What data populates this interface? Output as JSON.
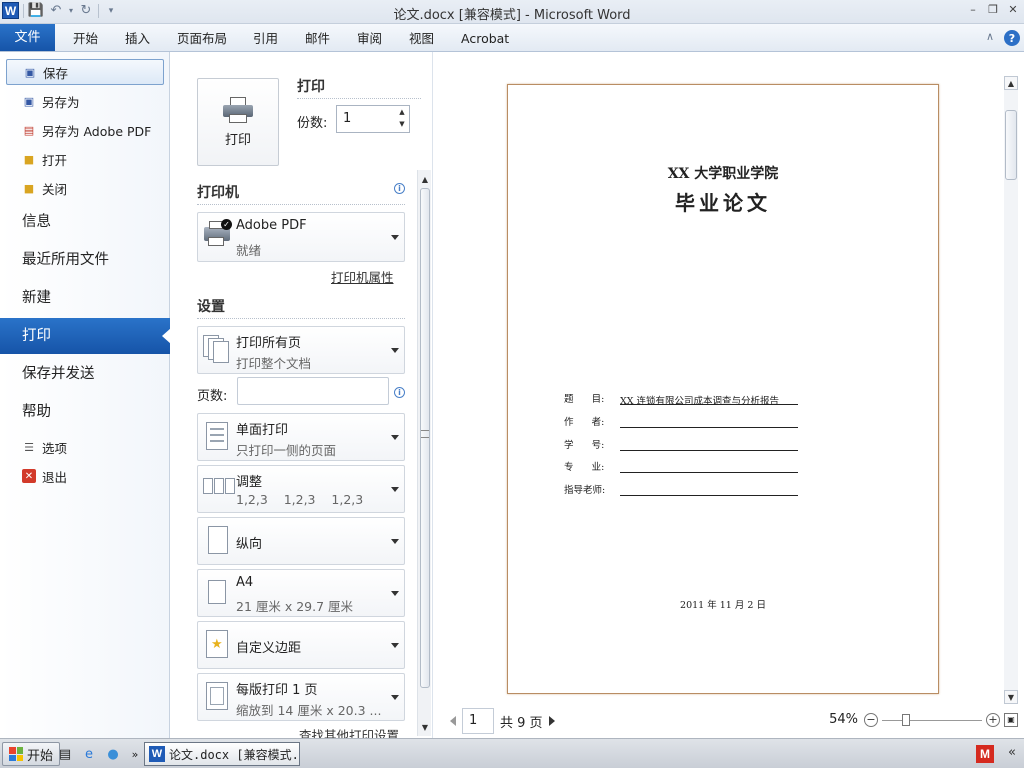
{
  "window": {
    "title": "论文.docx [兼容模式] - Microsoft Word",
    "word_logo": "W"
  },
  "ribbon": {
    "file_tab": "文件",
    "tabs": [
      "开始",
      "插入",
      "页面布局",
      "引用",
      "邮件",
      "审阅",
      "视图",
      "Acrobat"
    ],
    "help": "?"
  },
  "backstage_nav": {
    "small_items": [
      {
        "label": "保存",
        "icon": "save-icon"
      },
      {
        "label": "另存为",
        "icon": "save-as-icon"
      },
      {
        "label": "另存为 Adobe PDF",
        "icon": "pdf-icon"
      },
      {
        "label": "打开",
        "icon": "folder-open-icon"
      },
      {
        "label": "关闭",
        "icon": "folder-close-icon"
      }
    ],
    "big_items": [
      "信息",
      "最近所用文件",
      "新建",
      "打印",
      "保存并发送",
      "帮助"
    ],
    "bottom_items": [
      {
        "label": "选项",
        "icon": "options-icon"
      },
      {
        "label": "退出",
        "icon": "exit-icon"
      }
    ],
    "active": "打印"
  },
  "print_panel": {
    "print_button": "打印",
    "print_heading": "打印",
    "copies_label": "份数:",
    "copies_value": "1",
    "printer_heading": "打印机",
    "printer_name": "Adobe PDF",
    "printer_status": "就绪",
    "printer_properties": "打印机属性",
    "settings_heading": "设置",
    "range_title": "打印所有页",
    "range_sub": "打印整个文档",
    "pages_label": "页数:",
    "pages_value": "",
    "sides_title": "单面打印",
    "sides_sub": "只打印一侧的页面",
    "collate_title": "调整",
    "collate_sub": "1,2,3    1,2,3    1,2,3",
    "orientation": "纵向",
    "paper_title": "A4",
    "paper_sub": "21 厘米 x 29.7 厘米",
    "margins": "自定义边距",
    "per_page_title": "每版打印 1 页",
    "per_page_sub": "缩放到 14 厘米 x 20.3 ...",
    "more_settings": "查找其他打印设置"
  },
  "preview": {
    "school": "XX 大学职业学院",
    "doc_title": "毕业论文",
    "fields": [
      {
        "key": "题      目:",
        "value": "XX 连锁有限公司成本调查与分析报告"
      },
      {
        "key": "作      者:",
        "value": ""
      },
      {
        "key": "学      号:",
        "value": ""
      },
      {
        "key": "专      业:",
        "value": ""
      },
      {
        "key": "指导老师:",
        "value": ""
      }
    ],
    "date": "2011 年 11 月 2 日",
    "current_page": "1",
    "total_pages": "共 9 页",
    "zoom": "54%",
    "zoom_level": 0.54
  },
  "taskbar": {
    "start": "开始",
    "task_label": "论文.docx [兼容模式...",
    "tray_icon": "M",
    "tray_arrow": "«"
  }
}
